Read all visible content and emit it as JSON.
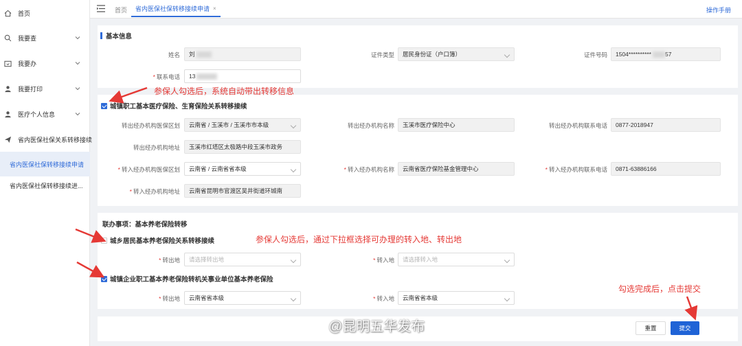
{
  "sidebar": {
    "items": [
      {
        "label": "首页",
        "icon": "home-icon"
      },
      {
        "label": "我要查",
        "icon": "search-icon"
      },
      {
        "label": "我要办",
        "icon": "folder-icon"
      },
      {
        "label": "我要打印",
        "icon": "user-icon"
      },
      {
        "label": "医疗个人信息",
        "icon": "user-icon"
      },
      {
        "label": "省内医保社保关系转移接续",
        "icon": "send-icon"
      }
    ],
    "subitems": [
      {
        "label": "省内医保社保转移接续申请",
        "active": true
      },
      {
        "label": "省内医保社保转移接续进..."
      }
    ]
  },
  "topbar": {
    "home_tab": "首页",
    "active_tab": "省内医保社保转移接续申请",
    "close": "×",
    "help": "操作手册"
  },
  "basic": {
    "title": "基本信息",
    "name_label": "姓名",
    "name_value": "刘",
    "idtype_label": "证件类型",
    "idtype_value": "居民身份证（户口簿）",
    "idno_label": "证件号码",
    "idno_value": "1504**********",
    "idno_suffix": "57",
    "phone_label": "联系电话",
    "phone_value": "13"
  },
  "medical": {
    "title": "城镇职工基本医疗保险、生育保险关系转移接续",
    "out_area_label": "转出经办机构医保区划",
    "out_area_value": "云南省 / 玉溪市 / 玉溪市市本级",
    "out_org_label": "转出经办机构名称",
    "out_org_value": "玉溪市医疗保险中心",
    "out_tel_label": "转出经办机构联系电话",
    "out_tel_value": "0877-2018947",
    "out_addr_label": "转出经办机构地址",
    "out_addr_value": "玉溪市红塔区太极路中段玉溪市政务",
    "in_area_label": "转入经办机构医保区划",
    "in_area_value": "云南省 / 云南省省本级",
    "in_org_label": "转入经办机构名称",
    "in_org_value": "云南省医疗保险基金管理中心",
    "in_tel_label": "转入经办机构联系电话",
    "in_tel_value": "0871-63886166",
    "in_addr_label": "转入经办机构地址",
    "in_addr_value": "云南省昆明市官渡区吴井街道环城南"
  },
  "pension": {
    "title": "联办事项：基本养老保险转移",
    "rural_title": "城乡居民基本养老保险关系转移接续",
    "out_label": "转出地",
    "out_placeholder": "请选择转出地",
    "in_label": "转入地",
    "in_placeholder": "请选择转入地",
    "urban_title": "城镇企业职工基本养老保险转机关事业单位基本养老保险",
    "urban_out_value": "云南省省本级",
    "urban_in_value": "云南省省本级"
  },
  "annotations": {
    "a1": "参保人勾选后，系统自动带出转移信息",
    "a2": "参保人勾选后，通过下拉框选择可办理的转入地、转出地",
    "a3": "勾选完成后，点击提交"
  },
  "actions": {
    "reset": "重置",
    "submit": "提交"
  },
  "watermark": "@昆明五华发布",
  "colors": {
    "accent": "#2f6bd8",
    "annotation": "#e53935"
  }
}
